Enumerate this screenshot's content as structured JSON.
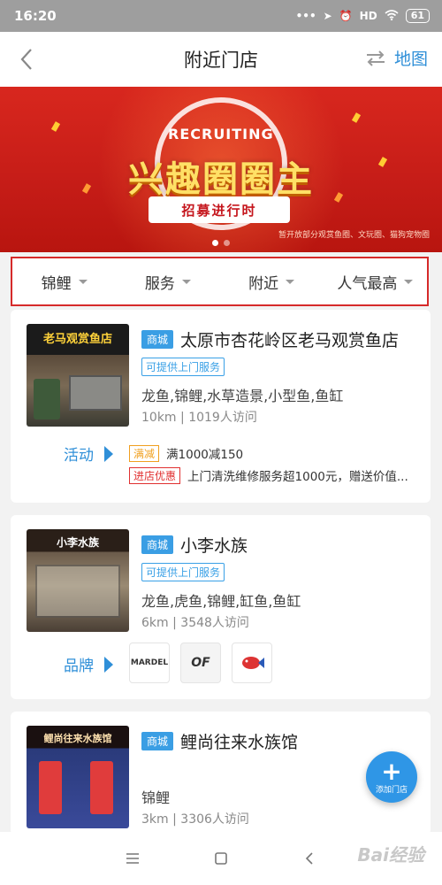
{
  "status_bar": {
    "time": "16:20",
    "signal": "HD",
    "battery": "61"
  },
  "header": {
    "title": "附近门店",
    "map_label": "地图"
  },
  "banner": {
    "recruiting_text": "RECRUITING",
    "main_text": "兴趣圈圈主",
    "sub_text": "招募进行时",
    "note": "暂开放部分观赏鱼圈、文玩圈、猫狗宠物圈",
    "page_count": 2,
    "active_page": 1
  },
  "filters": [
    {
      "label": "锦鲤"
    },
    {
      "label": "服务"
    },
    {
      "label": "附近"
    },
    {
      "label": "人气最高"
    }
  ],
  "stores": [
    {
      "mall_tag": "商城",
      "name": "太原市杏花岭区老马观赏鱼店",
      "thumb_sign": "老马观赏鱼店",
      "service_tag": "可提供上门服务",
      "categories": "龙鱼,锦鲤,水草造景,小型鱼,鱼缸",
      "distance": "10km",
      "visits": "1019人访问",
      "promo_label": "活动",
      "promos": [
        {
          "tag": "满减",
          "text": "满1000减150"
        },
        {
          "tag": "进店优惠",
          "text": "上门清洗维修服务超1000元，赠送价值..."
        }
      ]
    },
    {
      "mall_tag": "商城",
      "name": "小李水族",
      "thumb_sign": "小李水族",
      "service_tag": "可提供上门服务",
      "categories": "龙鱼,虎鱼,锦鲤,缸鱼,鱼缸",
      "distance": "6km",
      "visits": "3548人访问",
      "promo_label": "品牌",
      "brands": [
        {
          "name": "MARDEL"
        },
        {
          "name": "OF"
        },
        {
          "name": "brand-3"
        }
      ]
    },
    {
      "mall_tag": "商城",
      "name": "鲤尚往来水族馆",
      "thumb_sign": "鲤尚往来水族馆",
      "categories": "锦鲤",
      "distance": "3km",
      "visits": "3306人访问"
    }
  ],
  "fab": {
    "label": "添加门店"
  },
  "watermark": "Bai经验",
  "colors": {
    "accent": "#2f8fd8",
    "banner_red": "#c51c17",
    "filter_border": "#d62a2a"
  }
}
